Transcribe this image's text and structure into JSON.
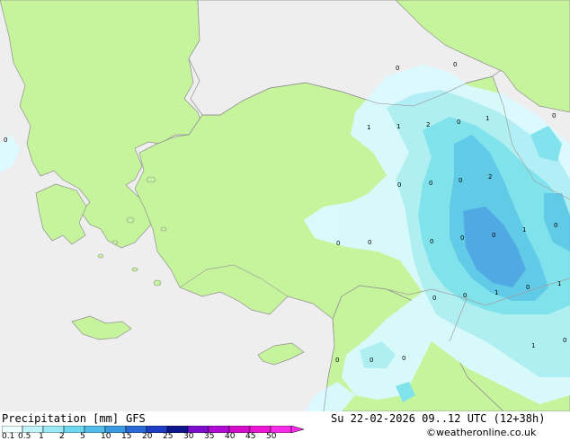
{
  "title": "Precipitation [mm]",
  "model": "GFS",
  "datetime": "Su 22-02-2026 09..12 UTC (12+38h)",
  "credit": "©weatheronline.co.uk",
  "colors": {
    "sea": "#eeeeee",
    "land": "#c6f49c",
    "coast": "#909090",
    "border": "#a0a0a0",
    "precip_01": "#dafaff",
    "precip_05": "#aeeff6",
    "precip_1": "#7de3f0",
    "precip_2": "#5cc8eb",
    "precip_5": "#4aa6e6"
  },
  "legend": {
    "ticks": [
      "0.1",
      "0.5",
      "1",
      "2",
      "5",
      "10",
      "15",
      "20",
      "25",
      "30",
      "35",
      "40",
      "45",
      "50"
    ],
    "colors": [
      "#eeffff",
      "#c0f4f9",
      "#9ae9f5",
      "#6ed8ee",
      "#52bde9",
      "#3a9ae0",
      "#2a68d6",
      "#1e3cc4",
      "#0c168a",
      "#7d0dcd",
      "#b00bd2",
      "#d20cc8",
      "#ea18d2",
      "#f82ce6"
    ]
  },
  "station_values": [
    "0",
    "0",
    "0",
    "1",
    "1",
    "2",
    "0",
    "1",
    "0",
    "0",
    "0",
    "2",
    "0",
    "1",
    "0",
    "0",
    "0",
    "0",
    "0",
    "1",
    "0",
    "0",
    "1",
    "0",
    "0",
    "0",
    "0",
    "1",
    "0",
    "0"
  ]
}
